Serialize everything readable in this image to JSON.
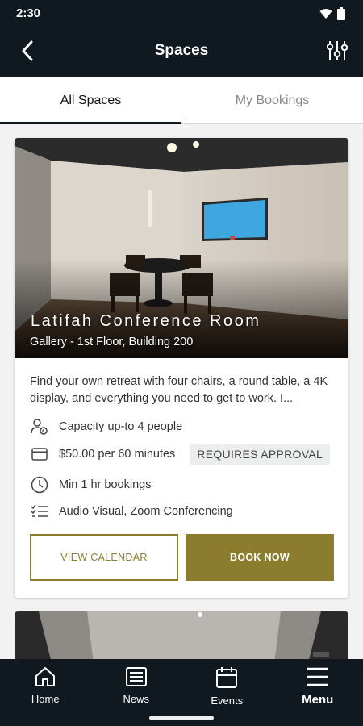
{
  "status_bar": {
    "time": "2:30"
  },
  "app_bar": {
    "title": "Spaces"
  },
  "tabs": [
    {
      "label": "All Spaces",
      "active": true
    },
    {
      "label": "My Bookings",
      "active": false
    }
  ],
  "space_card": {
    "name": "Latifah Conference Room",
    "location": "Gallery - 1st Floor, Building 200",
    "description": "Find your own retreat with four chairs, a round table, a 4K display, and everything you need to get to work.  I...",
    "capacity": "Capacity up-to 4 people",
    "price": "$50.00 per 60 minutes",
    "approval_badge": "REQUIRES APPROVAL",
    "min_booking": "Min 1 hr bookings",
    "amenities": "Audio Visual, Zoom Conferencing",
    "view_calendar_label": "VIEW CALENDAR",
    "book_now_label": "BOOK NOW"
  },
  "bottom_nav": [
    {
      "label": "Home",
      "icon": "home-icon"
    },
    {
      "label": "News",
      "icon": "news-icon"
    },
    {
      "label": "Events",
      "icon": "calendar-icon"
    },
    {
      "label": "Menu",
      "icon": "menu-icon"
    }
  ],
  "colors": {
    "brand_dark": "#101820",
    "accent_gold": "#8c7d2e"
  }
}
